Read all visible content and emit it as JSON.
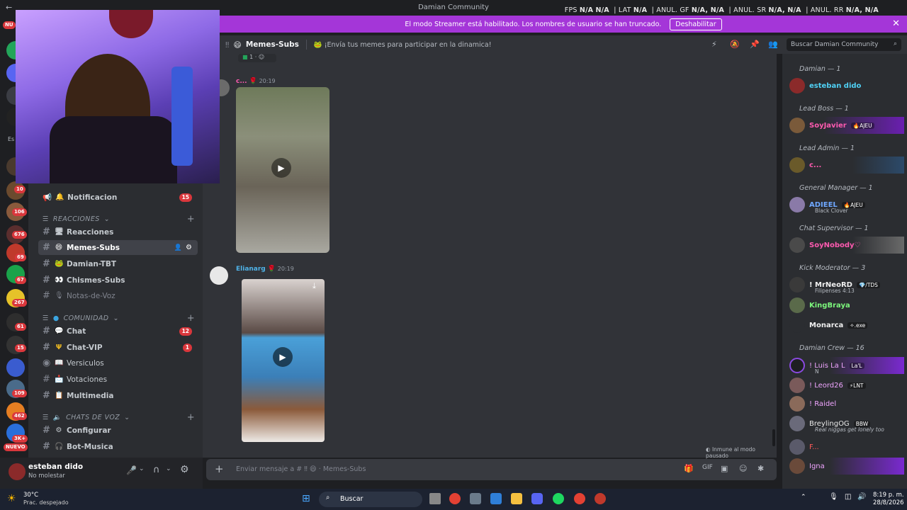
{
  "window": {
    "title": "Damian Community"
  },
  "overlay": {
    "fps_label": "FPS",
    "fps_v1": "N/A",
    "fps_v2": "N/A",
    "lat_label": "LAT",
    "lat_v": "N/A",
    "anul_gf_label": "ANUL. GF",
    "anul_gf_v": "N/A, N/A",
    "anul_sr_label": "ANUL. SR",
    "anul_sr_v": "N/A, N/A",
    "anul_rr_label": "ANUL. RR",
    "anul_rr_v": "N/A, N/A"
  },
  "banner": {
    "text": "El modo Streamer está habilitado. Los nombres de usuario se han truncado.",
    "button": "Deshabilitar"
  },
  "rail": {
    "nuevo": "NUEVO",
    "top_badge": "NU",
    "badges": [
      "10",
      "106",
      "676",
      "69",
      "67",
      "267",
      "61",
      "15",
      "109",
      "462",
      "3K+"
    ],
    "es": "Es"
  },
  "sidebar": {
    "channels_top": [
      {
        "name": "Notificacion",
        "count": "15"
      }
    ],
    "cat_reacciones": "REACCIONES",
    "reacciones": [
      {
        "name": "Reacciones"
      },
      {
        "name": "Memes-Subs"
      },
      {
        "name": "Damian-TBT"
      },
      {
        "name": "Chismes-Subs"
      },
      {
        "name": "Notas-de-Voz"
      }
    ],
    "cat_comunidad": "COMUNIDAD",
    "comunidad": [
      {
        "name": "Chat",
        "count": "12"
      },
      {
        "name": "Chat-VIP",
        "count": "1"
      },
      {
        "name": "Versiculos"
      },
      {
        "name": "Votaciones"
      },
      {
        "name": "Multimedia"
      }
    ],
    "cat_voz": "CHATS DE VOZ",
    "voz": [
      {
        "name": "Configurar"
      },
      {
        "name": "Bot-Musica"
      }
    ]
  },
  "user": {
    "name": "esteban dido",
    "status": "No molestar"
  },
  "header": {
    "channel": "Memes-Subs",
    "topic": "¡Envía tus memes para participar en la dinamica!",
    "search": "Buscar Damian Community"
  },
  "messages": [
    {
      "author": "c...",
      "time": "20:19"
    },
    {
      "author": "Elianarg",
      "time": "20:19"
    }
  ],
  "reaction_count": "1",
  "pause_note": "Inmune al modo pausado",
  "composer": {
    "placeholder": "Enviar mensaje a # ‼ 😄 · Memes-Subs"
  },
  "members": {
    "groups": [
      {
        "label": "Damian — 1",
        "members": [
          {
            "name": "esteban dido",
            "color": "#4fd1f5"
          }
        ]
      },
      {
        "label": "Lead Boss — 1",
        "members": [
          {
            "name": "SoyJavier",
            "color": "#ff5ab0",
            "tag": "🔥AJEU"
          }
        ]
      },
      {
        "label": "Lead Admin — 1",
        "members": [
          {
            "name": "c...",
            "color": "#ff5ab0"
          }
        ]
      },
      {
        "label": "General Manager — 1",
        "members": [
          {
            "name": "ADIEEL",
            "color": "#6fa8ff",
            "tag": "🔥AJEU",
            "sub": "Black Clover"
          }
        ]
      },
      {
        "label": "Chat Supervisor — 1",
        "members": [
          {
            "name": "SoyNobody♡",
            "color": "#ff5ab0"
          }
        ]
      },
      {
        "label": "Kick Moderator — 3",
        "members": [
          {
            "name": "! MrNeoRD",
            "color": "#f0f0f0",
            "tag": "💎/TDS",
            "sub": "Filipenses 4:13"
          },
          {
            "name": "KingBraya",
            "color": "#7cf67c"
          },
          {
            "name": "Monarca",
            "color": "#f0f0f0",
            "tag": "✧.exe"
          }
        ]
      },
      {
        "label": "Damian Crew — 16",
        "members": [
          {
            "name": "! Luis La L",
            "color": "#f0a5ff",
            "tag": "La'L",
            "sub": "N"
          },
          {
            "name": "! Leord26",
            "color": "#f0a5ff",
            "tag": "⚡LNT"
          },
          {
            "name": "! Raidel",
            "color": "#f0a5ff"
          },
          {
            "name": "BreylingOG",
            "color": "#e9e9e9",
            "tag": "BBW",
            "sub": "Real niggas get lonely too"
          },
          {
            "name": "F...",
            "color": "#ff5a5a"
          },
          {
            "name": "Igna",
            "color": "#f0a5ff"
          }
        ]
      }
    ]
  },
  "taskbar": {
    "weather_temp": "30°C",
    "weather_desc": "Prac. despejado",
    "search": "Buscar",
    "time": "8:19 p. m.",
    "date": "28/8/2026"
  },
  "colors": {
    "accent": "#a436d8",
    "bg": "#313338",
    "sidebar": "#2b2d31"
  }
}
